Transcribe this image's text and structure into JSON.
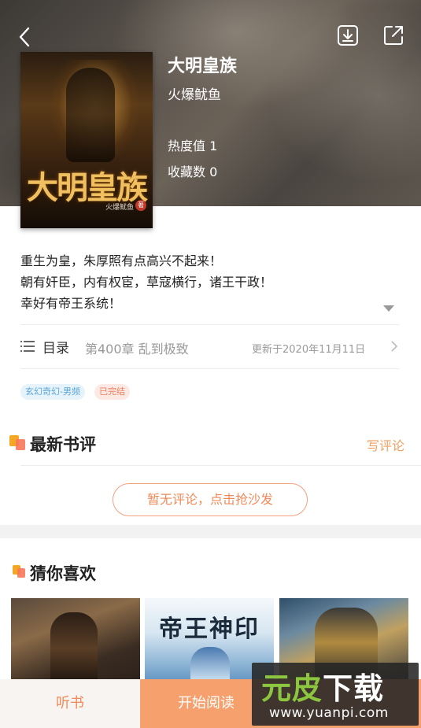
{
  "book": {
    "title": "大明皇族",
    "author": "火爆鱿鱼",
    "heat": "热度值 1",
    "favorites": "收藏数 0",
    "cover": {
      "title": "大明皇族",
      "author": "火爆鱿鱼",
      "seal": "著"
    },
    "intro": [
      "重生为皇，朱厚照有点高兴不起来！",
      "朝有奸臣，内有权宦，草寇横行，诸王干政！",
      "幸好有帝王系统！"
    ],
    "toc": {
      "label": "目录",
      "latest_chapter": "第400章 乱到极致",
      "updated": "更新于2020年11月11日"
    },
    "tags": {
      "genre": "玄幻奇幻-男频",
      "status": "已完结"
    }
  },
  "reviews": {
    "title": "最新书评",
    "write_label": "写评论",
    "empty_button": "暂无评论，点击抢沙发"
  },
  "recommend": {
    "title": "猜你喜欢",
    "items": [
      {
        "cover_title": ""
      },
      {
        "cover_title": "帝王神印"
      },
      {
        "cover_title": ""
      }
    ]
  },
  "bottom_bar": {
    "listen_label": "听书",
    "read_label": "开始阅读"
  },
  "watermark": {
    "logo_a": "元皮",
    "logo_b": "下载",
    "url": "www.yuanpi.com"
  },
  "colors": {
    "accent": "#f6a06e",
    "accent_text": "#f08a5a",
    "tag_genre_bg": "#e6f3fb",
    "tag_status_bg": "#fde9e3"
  }
}
